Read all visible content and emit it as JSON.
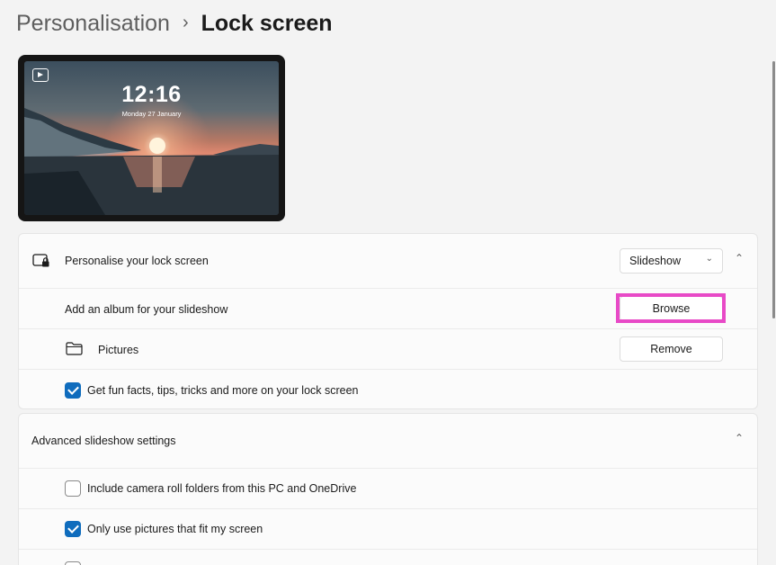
{
  "breadcrumb": {
    "parent": "Personalisation",
    "separator": "›",
    "current": "Lock screen"
  },
  "preview": {
    "time": "12:16",
    "date": "Monday 27 January",
    "icon": "slideshow-icon"
  },
  "lock_screen_card": {
    "personalise": {
      "label": "Personalise your lock screen",
      "icon": "lock-screen-icon",
      "dropdown_value": "Slideshow",
      "expanded": true
    },
    "album": {
      "label": "Add an album for your slideshow",
      "button": "Browse"
    },
    "folder": {
      "label": "Pictures",
      "icon": "folder-icon",
      "button": "Remove"
    },
    "fun_facts": {
      "label": "Get fun facts, tips, tricks and more on your lock screen",
      "checked": true
    }
  },
  "advanced_card": {
    "title": "Advanced slideshow settings",
    "expanded": true,
    "options": [
      {
        "label": "Include camera roll folders from this PC and OneDrive",
        "checked": false
      },
      {
        "label": "Only use pictures that fit my screen",
        "checked": true
      }
    ]
  },
  "colors": {
    "accent": "#0f6cbd",
    "highlight": "#e84ac7",
    "background": "#f3f3f3"
  }
}
